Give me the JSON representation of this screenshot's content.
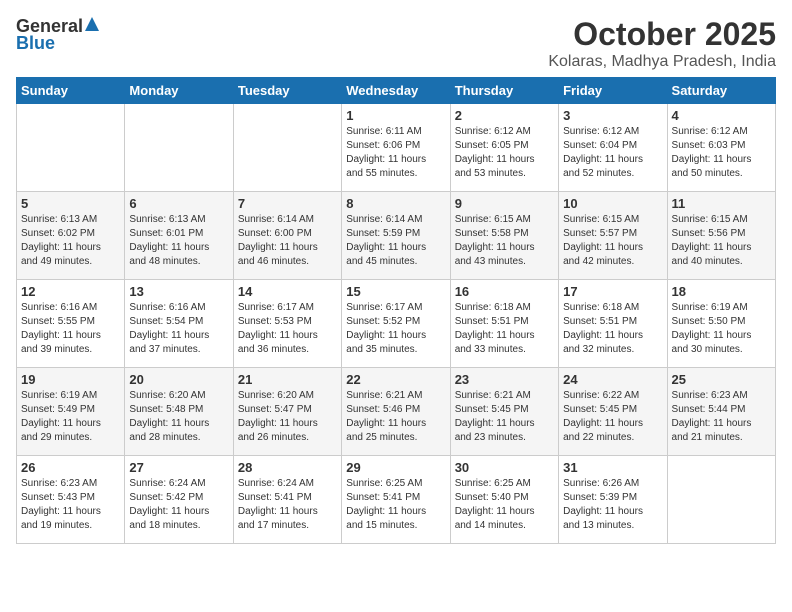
{
  "header": {
    "logo_general": "General",
    "logo_blue": "Blue",
    "month_title": "October 2025",
    "location": "Kolaras, Madhya Pradesh, India"
  },
  "weekdays": [
    "Sunday",
    "Monday",
    "Tuesday",
    "Wednesday",
    "Thursday",
    "Friday",
    "Saturday"
  ],
  "weeks": [
    [
      {
        "day": "",
        "info": ""
      },
      {
        "day": "",
        "info": ""
      },
      {
        "day": "",
        "info": ""
      },
      {
        "day": "1",
        "info": "Sunrise: 6:11 AM\nSunset: 6:06 PM\nDaylight: 11 hours\nand 55 minutes."
      },
      {
        "day": "2",
        "info": "Sunrise: 6:12 AM\nSunset: 6:05 PM\nDaylight: 11 hours\nand 53 minutes."
      },
      {
        "day": "3",
        "info": "Sunrise: 6:12 AM\nSunset: 6:04 PM\nDaylight: 11 hours\nand 52 minutes."
      },
      {
        "day": "4",
        "info": "Sunrise: 6:12 AM\nSunset: 6:03 PM\nDaylight: 11 hours\nand 50 minutes."
      }
    ],
    [
      {
        "day": "5",
        "info": "Sunrise: 6:13 AM\nSunset: 6:02 PM\nDaylight: 11 hours\nand 49 minutes."
      },
      {
        "day": "6",
        "info": "Sunrise: 6:13 AM\nSunset: 6:01 PM\nDaylight: 11 hours\nand 48 minutes."
      },
      {
        "day": "7",
        "info": "Sunrise: 6:14 AM\nSunset: 6:00 PM\nDaylight: 11 hours\nand 46 minutes."
      },
      {
        "day": "8",
        "info": "Sunrise: 6:14 AM\nSunset: 5:59 PM\nDaylight: 11 hours\nand 45 minutes."
      },
      {
        "day": "9",
        "info": "Sunrise: 6:15 AM\nSunset: 5:58 PM\nDaylight: 11 hours\nand 43 minutes."
      },
      {
        "day": "10",
        "info": "Sunrise: 6:15 AM\nSunset: 5:57 PM\nDaylight: 11 hours\nand 42 minutes."
      },
      {
        "day": "11",
        "info": "Sunrise: 6:15 AM\nSunset: 5:56 PM\nDaylight: 11 hours\nand 40 minutes."
      }
    ],
    [
      {
        "day": "12",
        "info": "Sunrise: 6:16 AM\nSunset: 5:55 PM\nDaylight: 11 hours\nand 39 minutes."
      },
      {
        "day": "13",
        "info": "Sunrise: 6:16 AM\nSunset: 5:54 PM\nDaylight: 11 hours\nand 37 minutes."
      },
      {
        "day": "14",
        "info": "Sunrise: 6:17 AM\nSunset: 5:53 PM\nDaylight: 11 hours\nand 36 minutes."
      },
      {
        "day": "15",
        "info": "Sunrise: 6:17 AM\nSunset: 5:52 PM\nDaylight: 11 hours\nand 35 minutes."
      },
      {
        "day": "16",
        "info": "Sunrise: 6:18 AM\nSunset: 5:51 PM\nDaylight: 11 hours\nand 33 minutes."
      },
      {
        "day": "17",
        "info": "Sunrise: 6:18 AM\nSunset: 5:51 PM\nDaylight: 11 hours\nand 32 minutes."
      },
      {
        "day": "18",
        "info": "Sunrise: 6:19 AM\nSunset: 5:50 PM\nDaylight: 11 hours\nand 30 minutes."
      }
    ],
    [
      {
        "day": "19",
        "info": "Sunrise: 6:19 AM\nSunset: 5:49 PM\nDaylight: 11 hours\nand 29 minutes."
      },
      {
        "day": "20",
        "info": "Sunrise: 6:20 AM\nSunset: 5:48 PM\nDaylight: 11 hours\nand 28 minutes."
      },
      {
        "day": "21",
        "info": "Sunrise: 6:20 AM\nSunset: 5:47 PM\nDaylight: 11 hours\nand 26 minutes."
      },
      {
        "day": "22",
        "info": "Sunrise: 6:21 AM\nSunset: 5:46 PM\nDaylight: 11 hours\nand 25 minutes."
      },
      {
        "day": "23",
        "info": "Sunrise: 6:21 AM\nSunset: 5:45 PM\nDaylight: 11 hours\nand 23 minutes."
      },
      {
        "day": "24",
        "info": "Sunrise: 6:22 AM\nSunset: 5:45 PM\nDaylight: 11 hours\nand 22 minutes."
      },
      {
        "day": "25",
        "info": "Sunrise: 6:23 AM\nSunset: 5:44 PM\nDaylight: 11 hours\nand 21 minutes."
      }
    ],
    [
      {
        "day": "26",
        "info": "Sunrise: 6:23 AM\nSunset: 5:43 PM\nDaylight: 11 hours\nand 19 minutes."
      },
      {
        "day": "27",
        "info": "Sunrise: 6:24 AM\nSunset: 5:42 PM\nDaylight: 11 hours\nand 18 minutes."
      },
      {
        "day": "28",
        "info": "Sunrise: 6:24 AM\nSunset: 5:41 PM\nDaylight: 11 hours\nand 17 minutes."
      },
      {
        "day": "29",
        "info": "Sunrise: 6:25 AM\nSunset: 5:41 PM\nDaylight: 11 hours\nand 15 minutes."
      },
      {
        "day": "30",
        "info": "Sunrise: 6:25 AM\nSunset: 5:40 PM\nDaylight: 11 hours\nand 14 minutes."
      },
      {
        "day": "31",
        "info": "Sunrise: 6:26 AM\nSunset: 5:39 PM\nDaylight: 11 hours\nand 13 minutes."
      },
      {
        "day": "",
        "info": ""
      }
    ]
  ]
}
